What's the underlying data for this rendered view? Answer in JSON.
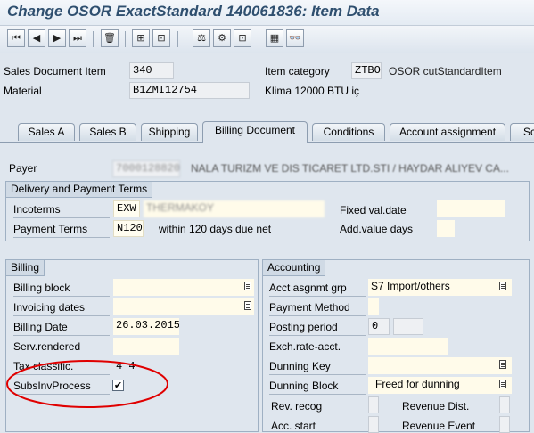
{
  "window": {
    "title": "Change OSOR ExactStandard 140061836: Item Data"
  },
  "toolbar": {
    "buttons": [
      "first-item-icon",
      "previous-item-icon",
      "next-item-icon",
      "last-item-icon",
      "delete-icon",
      "display-document-header-icon",
      "item-overview-icon",
      "item-conditions-icon",
      "item-schedule-lines-icon",
      "calculator-icon",
      "glasses-icon"
    ],
    "glyphs": {
      "first": "⏮",
      "prev": "◀",
      "next": "▶",
      "last": "⏭",
      "delete": "🗑",
      "header": "⊞",
      "overview": "⊡",
      "cond": "⚖",
      "sched": "⚙",
      "calc": "▦",
      "glasses": "👓"
    }
  },
  "header": {
    "sales_doc_item_label": "Sales Document Item",
    "sales_doc_item_value": "340",
    "item_category_label": "Item category",
    "item_category_value": "ZTBO",
    "item_category_desc": "OSOR cutStandardItem",
    "material_label": "Material",
    "material_value": "B1ZMI12754",
    "material_desc": "Klima 12000 BTU iç"
  },
  "tabs": [
    {
      "label": "Sales A",
      "active": false
    },
    {
      "label": "Sales B",
      "active": false
    },
    {
      "label": "Shipping",
      "active": false
    },
    {
      "label": "Billing Document",
      "active": true
    },
    {
      "label": "Conditions",
      "active": false
    },
    {
      "label": "Account assignment",
      "active": false
    },
    {
      "label": "Sc",
      "active": false
    }
  ],
  "payer": {
    "label": "Payer",
    "value": "7000128820",
    "desc": "NALA TURIZM VE DIS TICARET LTD.STI / HAYDAR ALIYEV CA..."
  },
  "delivery": {
    "title": "Delivery and Payment Terms",
    "incoterms_label": "Incoterms",
    "incoterms_value": "EXW",
    "incoterms_desc": "THERMAKOY",
    "fixed_val_date_label": "Fixed val.date",
    "fixed_val_date_value": "",
    "payment_terms_label": "Payment Terms",
    "payment_terms_value": "N120",
    "payment_terms_desc": "within 120 days due net",
    "add_value_days_label": "Add.value days",
    "add_value_days_value": ""
  },
  "billing": {
    "title": "Billing",
    "billing_block_label": "Billing block",
    "billing_block_value": "",
    "invoicing_dates_label": "Invoicing dates",
    "invoicing_dates_value": "",
    "billing_date_label": "Billing Date",
    "billing_date_value": "26.03.2015",
    "serv_rendered_label": "Serv.rendered",
    "serv_rendered_value": "",
    "tax_classific_label": "Tax classific.",
    "tax_classific_value": "4 4",
    "subs_inv_process_label": "SubsInvProcess",
    "subs_inv_process_checked": "✔",
    "highlight_color": "#e00000"
  },
  "accounting": {
    "title": "Accounting",
    "acct_asgnmt_grp_label": "Acct asgnmt grp",
    "acct_asgnmt_grp_value": "S7 Import/others",
    "payment_method_label": "Payment Method",
    "payment_method_value": "",
    "posting_period_label": "Posting period",
    "posting_period_value": "0",
    "exch_rate_acct_label": "Exch.rate-acct.",
    "exch_rate_acct_value": "",
    "dunning_key_label": "Dunning Key",
    "dunning_key_value": "",
    "dunning_block_label": "Dunning Block",
    "dunning_block_value": "Freed for dunning",
    "rev_recog_label": "Rev. recog",
    "revenue_dist_label": "Revenue Dist.",
    "acc_start_label": "Acc. start",
    "revenue_event_label": "Revenue Event"
  }
}
